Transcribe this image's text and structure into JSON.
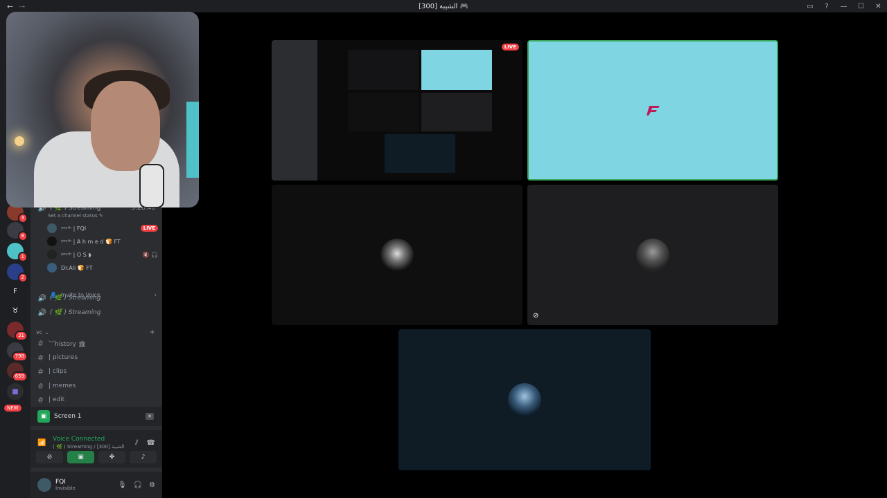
{
  "window": {
    "title": "الشيبة [300] 🎮",
    "nav_back": "←",
    "nav_forward": "→",
    "inbox_icon": "▭",
    "help_icon": "?",
    "minimize": "—",
    "maximize": "☐",
    "close": "✕"
  },
  "server_rail": {
    "badges": [
      "3",
      "8",
      "1",
      "2",
      "31",
      "798",
      "659"
    ],
    "new_label": "NEW"
  },
  "channels": {
    "active_voice": {
      "name": "( 🌿 ) Streaming",
      "timer": "3:28:46",
      "status_prompt": "Set a channel status ✎"
    },
    "members": [
      {
        "name": "ʸᵒᵘᵗʰ | FQI",
        "tag": "LIVE"
      },
      {
        "name": "ʸᵒᵘᵗʰ | A h m e d 🍞 FT",
        "tag": ""
      },
      {
        "name": "ʸᵒᵘᵗʰ | O S ◗",
        "tag": "muted"
      },
      {
        "name": "Dr.Ali 🍞 FT",
        "tag": ""
      }
    ],
    "invite_label": "Invite to Voice",
    "other_voice": [
      "( 🌿 ) Streaming",
      "( 🌿 ) Streaming"
    ],
    "category": "vc",
    "text_channels": [
      "︶history 🏛",
      "| pictures",
      "| clips",
      "| memes",
      "| edit"
    ]
  },
  "panel": {
    "screen_label": "Screen 1",
    "voice_connected": "Voice Connected",
    "voice_sub": "( 🌿 ) Streaming / الشيبة [300]",
    "user_name": "FQI",
    "user_status": "Invisible"
  },
  "stage": {
    "live_tag": "LIVE"
  }
}
